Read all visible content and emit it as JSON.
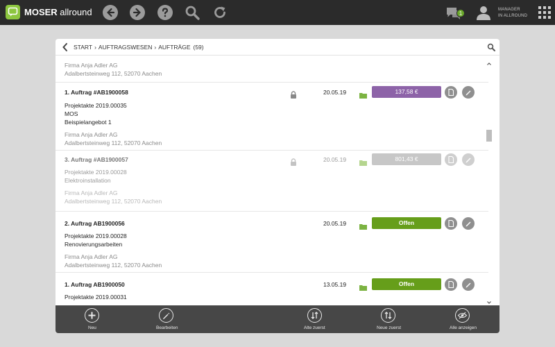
{
  "app": {
    "brand_bold": "MOSER",
    "brand_light": "allround",
    "chat_count": "1",
    "user_line1": "MANAGER",
    "user_line2": "IN ALLROUND"
  },
  "breadcrumb": {
    "start": "START",
    "section": "AUFTRAGSWESEN",
    "page": "AUFTRÄGE",
    "count": "(59)",
    "separator": "›"
  },
  "list": {
    "partial_top": {
      "company": "Firma Anja Adler AG",
      "address": "Adalbertsteinweg 112, 52070 Aachen"
    },
    "items": [
      {
        "title": "1. Auftrag #AB1900058",
        "locked": true,
        "date": "20.05.19",
        "status": "137,58 €",
        "status_color": "#8d63a8",
        "lines": [
          "Projektakte 2019.00035",
          "MOS",
          "Beispielangebot 1"
        ],
        "company": "Firma Anja Adler AG",
        "address": "Adalbertsteinweg 112, 52070 Aachen"
      },
      {
        "title": "3. Auftrag #AB1900057",
        "locked": true,
        "date": "20.05.19",
        "status": "801,43 €",
        "status_color": "#c7c7c7",
        "lines": [
          "Projektakte 2019.00028",
          "Elektroinstallation"
        ],
        "company": "Firma Anja Adler AG",
        "address": "Adalbertsteinweg 112, 52070 Aachen"
      },
      {
        "title": "2. Auftrag AB1900056",
        "locked": false,
        "date": "20.05.19",
        "status": "Offen",
        "status_color": "#669e1a",
        "lines": [
          "Projektakte 2019.00028",
          "Renovierungsarbeiten"
        ],
        "company": "Firma Anja Adler AG",
        "address": "Adalbertsteinweg 112, 52070 Aachen"
      },
      {
        "title": "1. Auftrag AB1900050",
        "locked": false,
        "date": "13.05.19",
        "status": "Offen",
        "status_color": "#669e1a",
        "lines": [
          "Projektakte 2019.00031"
        ]
      }
    ]
  },
  "toolbar": {
    "new": "Neu",
    "edit": "Bearbeiten",
    "oldest_first": "Alte zuerst",
    "newest_first": "Neue zuerst",
    "show_all": "Alle anzeigen"
  },
  "colors": {
    "accent_green": "#8dc63f",
    "topbar": "#2b2b2b",
    "toolbar": "#474747"
  }
}
